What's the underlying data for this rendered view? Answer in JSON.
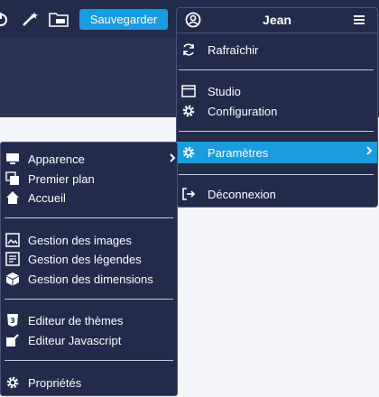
{
  "toolbar": {
    "save_label": "Sauvegarder",
    "icons": [
      "power-icon",
      "magic-wand-icon",
      "folder-icon"
    ]
  },
  "user_menu": {
    "name": "Jean",
    "items": {
      "refresh": "Rafraîchir",
      "studio": "Studio",
      "configuration": "Configuration",
      "parameters": "Paramètres",
      "logout": "Déconnexion"
    }
  },
  "settings_menu": {
    "appearance": "Apparence",
    "foreground": "Premier plan",
    "home": "Accueil",
    "images": "Gestion des images",
    "legends": "Gestion des légendes",
    "dimensions": "Gestion des dimensions",
    "theme_editor": "Editeur de thèmes",
    "js_editor": "Editeur Javascript",
    "properties": "Propriétés"
  },
  "colors": {
    "menu_bg": "#222c4a",
    "accent": "#1a9ce0",
    "separator": "#c5cad8"
  }
}
